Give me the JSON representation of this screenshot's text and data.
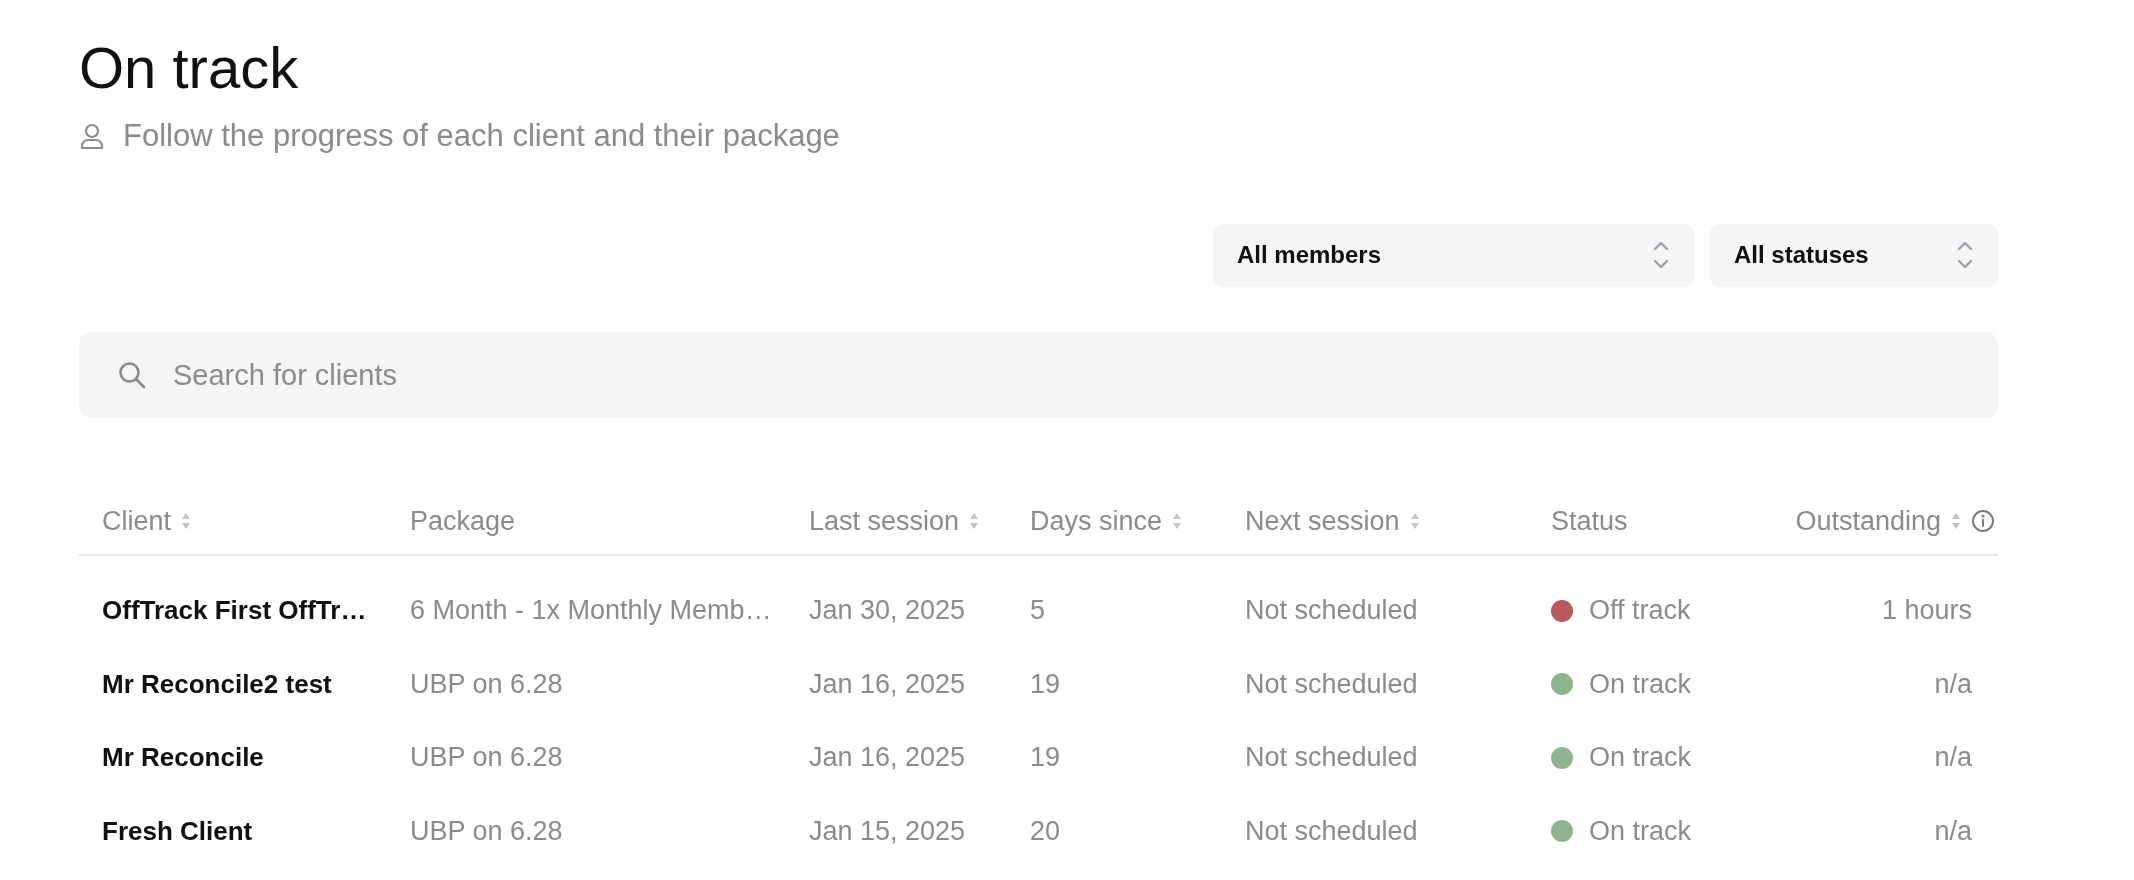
{
  "page": {
    "title": "On track",
    "subtitle": "Follow the progress of each client and their package"
  },
  "filters": [
    {
      "label": "All members"
    },
    {
      "label": "All statuses"
    }
  ],
  "search": {
    "placeholder": "Search for clients"
  },
  "table": {
    "columns": [
      {
        "label": "Client",
        "sortable": true,
        "info": false
      },
      {
        "label": "Package",
        "sortable": false,
        "info": false
      },
      {
        "label": "Last session",
        "sortable": true,
        "info": false
      },
      {
        "label": "Days since",
        "sortable": true,
        "info": false
      },
      {
        "label": "Next session",
        "sortable": true,
        "info": false
      },
      {
        "label": "Status",
        "sortable": false,
        "info": false
      },
      {
        "label": "Outstanding",
        "sortable": true,
        "info": true
      }
    ],
    "rows": [
      {
        "client": "OffTrack First OffTr…",
        "package": "6 Month - 1x Monthly Memb…",
        "last_session": "Jan 30, 2025",
        "days_since": "5",
        "next_session": "Not scheduled",
        "status": "Off track",
        "color": "#b85a60",
        "outstanding": "1 hours"
      },
      {
        "client": "Mr Reconcile2 test",
        "package": "UBP on 6.28",
        "last_session": "Jan 16, 2025",
        "days_since": "19",
        "next_session": "Not scheduled",
        "status": "On track",
        "color": "#8fb38f",
        "outstanding": "n/a"
      },
      {
        "client": "Mr Reconcile",
        "package": "UBP on 6.28",
        "last_session": "Jan 16, 2025",
        "days_since": "19",
        "next_session": "Not scheduled",
        "status": "On track",
        "color": "#8fb38f",
        "outstanding": "n/a"
      },
      {
        "client": "Fresh Client",
        "package": "UBP on 6.28",
        "last_session": "Jan 15, 2025",
        "days_since": "20",
        "next_session": "Not scheduled",
        "status": "On track",
        "color": "#8fb38f",
        "outstanding": "n/a"
      }
    ]
  }
}
